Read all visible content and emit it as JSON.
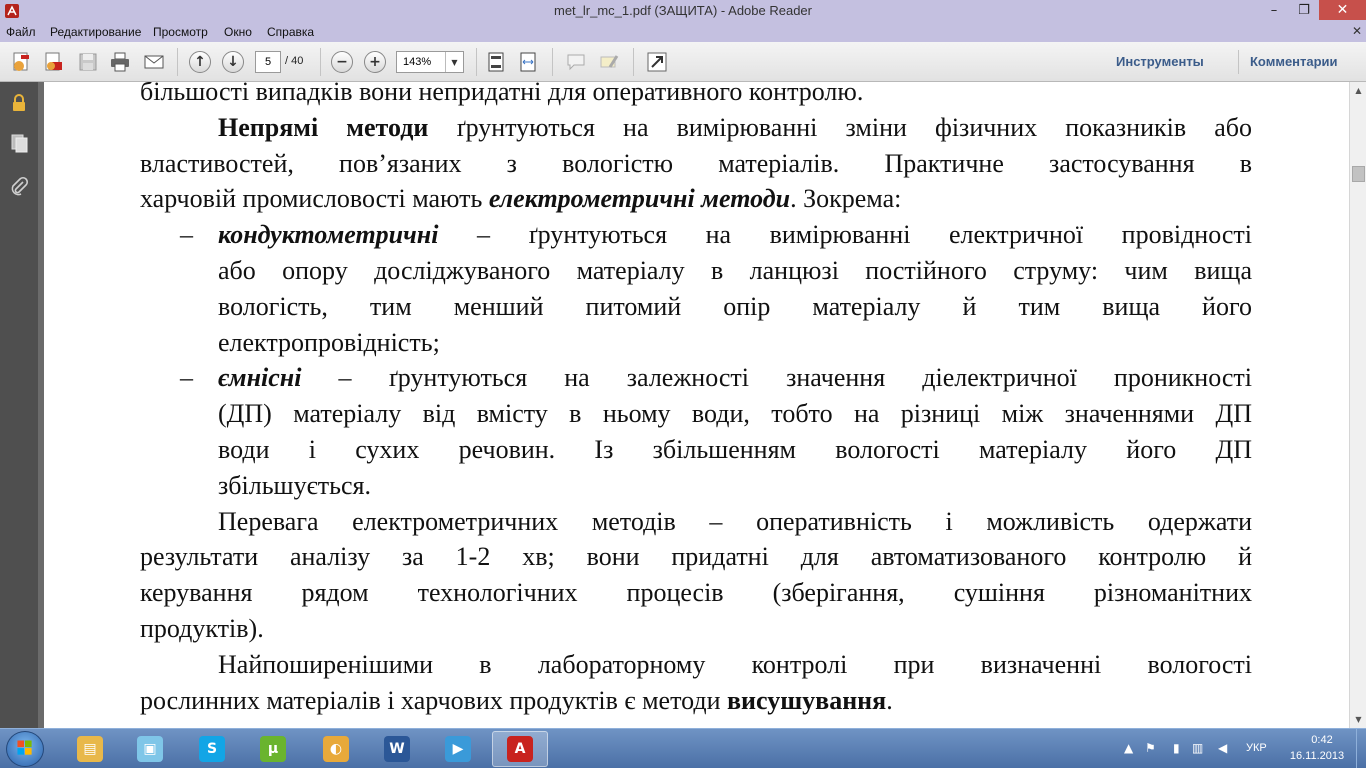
{
  "window": {
    "title": "met_lr_mc_1.pdf (ЗАЩИТА) - Adobe Reader",
    "minimize_glyph": "–",
    "maximize_glyph": "❐",
    "close_glyph": "✕"
  },
  "menu": {
    "items": [
      "Файл",
      "Редактирование",
      "Просмотр",
      "Окно",
      "Справка"
    ],
    "close_glyph": "✕"
  },
  "toolbar": {
    "current_page": "5",
    "total_pages": "/ 40",
    "zoom": "143%",
    "tools_label": "Инструменты",
    "comments_label": "Комментарии"
  },
  "document": {
    "lines": [
      {
        "type": "plain",
        "parts": [
          {
            "t": "більшості випадків вони непридатні для оперативного контролю."
          }
        ]
      },
      {
        "type": "indent",
        "parts": [
          {
            "t": "Непрямі методи",
            "b": true
          },
          {
            "t": " ґрунтуються на вимірюванні зміни фізичних показників або"
          }
        ]
      },
      {
        "type": "justify",
        "parts": [
          {
            "t": "властивостей, пов’язаних з вологістю матеріалів. Практичне застосування в"
          }
        ]
      },
      {
        "type": "plain",
        "parts": [
          {
            "t": "харчовій промисловості мають "
          },
          {
            "t": "електрометричні методи",
            "b": true,
            "i": true
          },
          {
            "t": ". Зокрема:"
          }
        ]
      },
      {
        "type": "bullet",
        "parts": [
          {
            "t": "кондуктометричні",
            "b": true,
            "i": true
          },
          {
            "t": " – ґрунтуються на вимірюванні електричної провідності"
          }
        ]
      },
      {
        "type": "cont",
        "parts": [
          {
            "t": "або опору досліджуваного матеріалу в ланцюзі постійного струму: чим вища"
          }
        ]
      },
      {
        "type": "cont",
        "parts": [
          {
            "t": "вологість, тим менший питомий опір матеріалу й тим вища його"
          }
        ]
      },
      {
        "type": "contlast",
        "parts": [
          {
            "t": "електропровідність;"
          }
        ]
      },
      {
        "type": "bullet",
        "parts": [
          {
            "t": "ємнісні",
            "b": true,
            "i": true
          },
          {
            "t": " – ґрунтуються на залежності значення діелектричної проникності"
          }
        ]
      },
      {
        "type": "cont",
        "parts": [
          {
            "t": "(ДП) матеріалу від вмісту в ньому води, тобто на різниці між значеннями ДП"
          }
        ]
      },
      {
        "type": "cont",
        "parts": [
          {
            "t": "води і сухих речовин. Із збільшенням вологості матеріалу його ДП"
          }
        ]
      },
      {
        "type": "contlast",
        "parts": [
          {
            "t": "збільшується."
          }
        ]
      },
      {
        "type": "indent",
        "parts": [
          {
            "t": "Перевага електрометричних методів – оперативність і можливість одержати"
          }
        ]
      },
      {
        "type": "justify",
        "parts": [
          {
            "t": "результати аналізу за 1-2 хв; вони придатні для автоматизованого контролю й"
          }
        ]
      },
      {
        "type": "justify",
        "parts": [
          {
            "t": "керування рядом технологічних процесів (зберігання, сушіння різноманітних"
          }
        ]
      },
      {
        "type": "plain",
        "parts": [
          {
            "t": "продуктів)."
          }
        ]
      },
      {
        "type": "indent",
        "parts": [
          {
            "t": "Найпоширенішими в лабораторному контролі при визначенні вологості"
          }
        ]
      },
      {
        "type": "plain",
        "parts": [
          {
            "t": "рослинних матеріалів і харчових продуктів є методи "
          },
          {
            "t": "висушування",
            "b": true
          },
          {
            "t": "."
          }
        ]
      }
    ],
    "bullet_glyph": "–"
  },
  "taskbar": {
    "apps": [
      {
        "name": "file-explorer",
        "glyph": "▤",
        "color": "#e8b84a"
      },
      {
        "name": "image-viewer",
        "glyph": "▣",
        "color": "#7fc6e8"
      },
      {
        "name": "skype",
        "glyph": "S",
        "color": "#12a5e6"
      },
      {
        "name": "utorrent",
        "glyph": "µ",
        "color": "#6ab42e"
      },
      {
        "name": "media-app",
        "glyph": "◐",
        "color": "#e8a93a"
      },
      {
        "name": "word",
        "glyph": "W",
        "color": "#2b5797"
      },
      {
        "name": "video-player",
        "glyph": "▶",
        "color": "#3a9ad9"
      },
      {
        "name": "adobe-reader",
        "glyph": "A",
        "color": "#c8231e"
      }
    ],
    "language": "УКР",
    "time": "0:42",
    "date": "16.11.2013"
  }
}
